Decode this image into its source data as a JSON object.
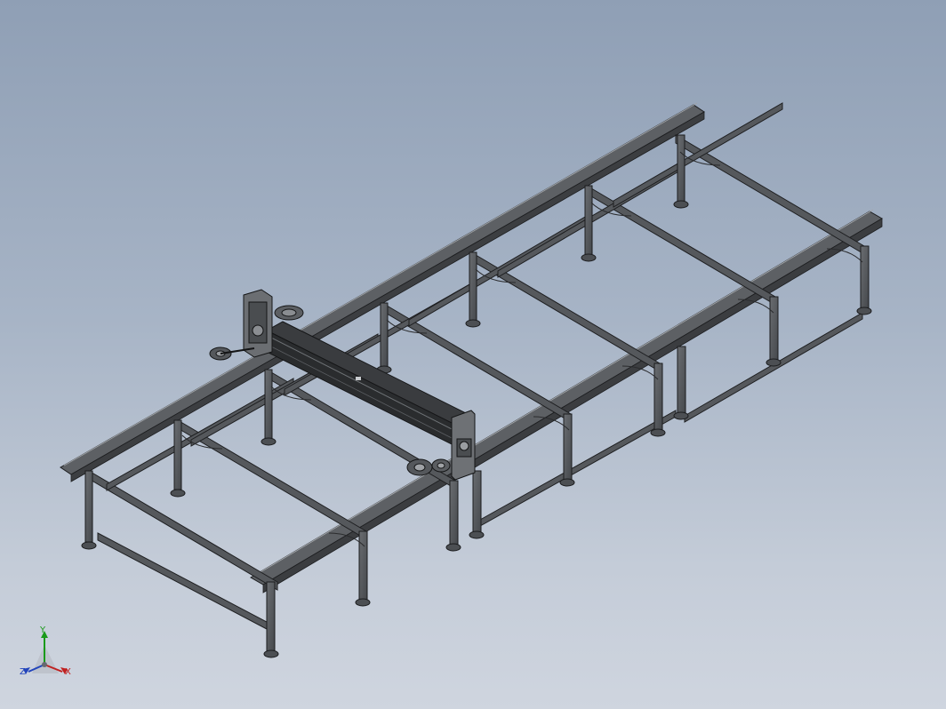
{
  "viewport": {
    "background_top": "#8f9fb5",
    "background_bottom": "#cfd5df",
    "model_color": "#5b5e62"
  },
  "triad": {
    "x_label": "X",
    "y_label": "Y",
    "z_label": "Z",
    "x_color": "#c02020",
    "y_color": "#1a9a1a",
    "z_color": "#2244bb"
  }
}
